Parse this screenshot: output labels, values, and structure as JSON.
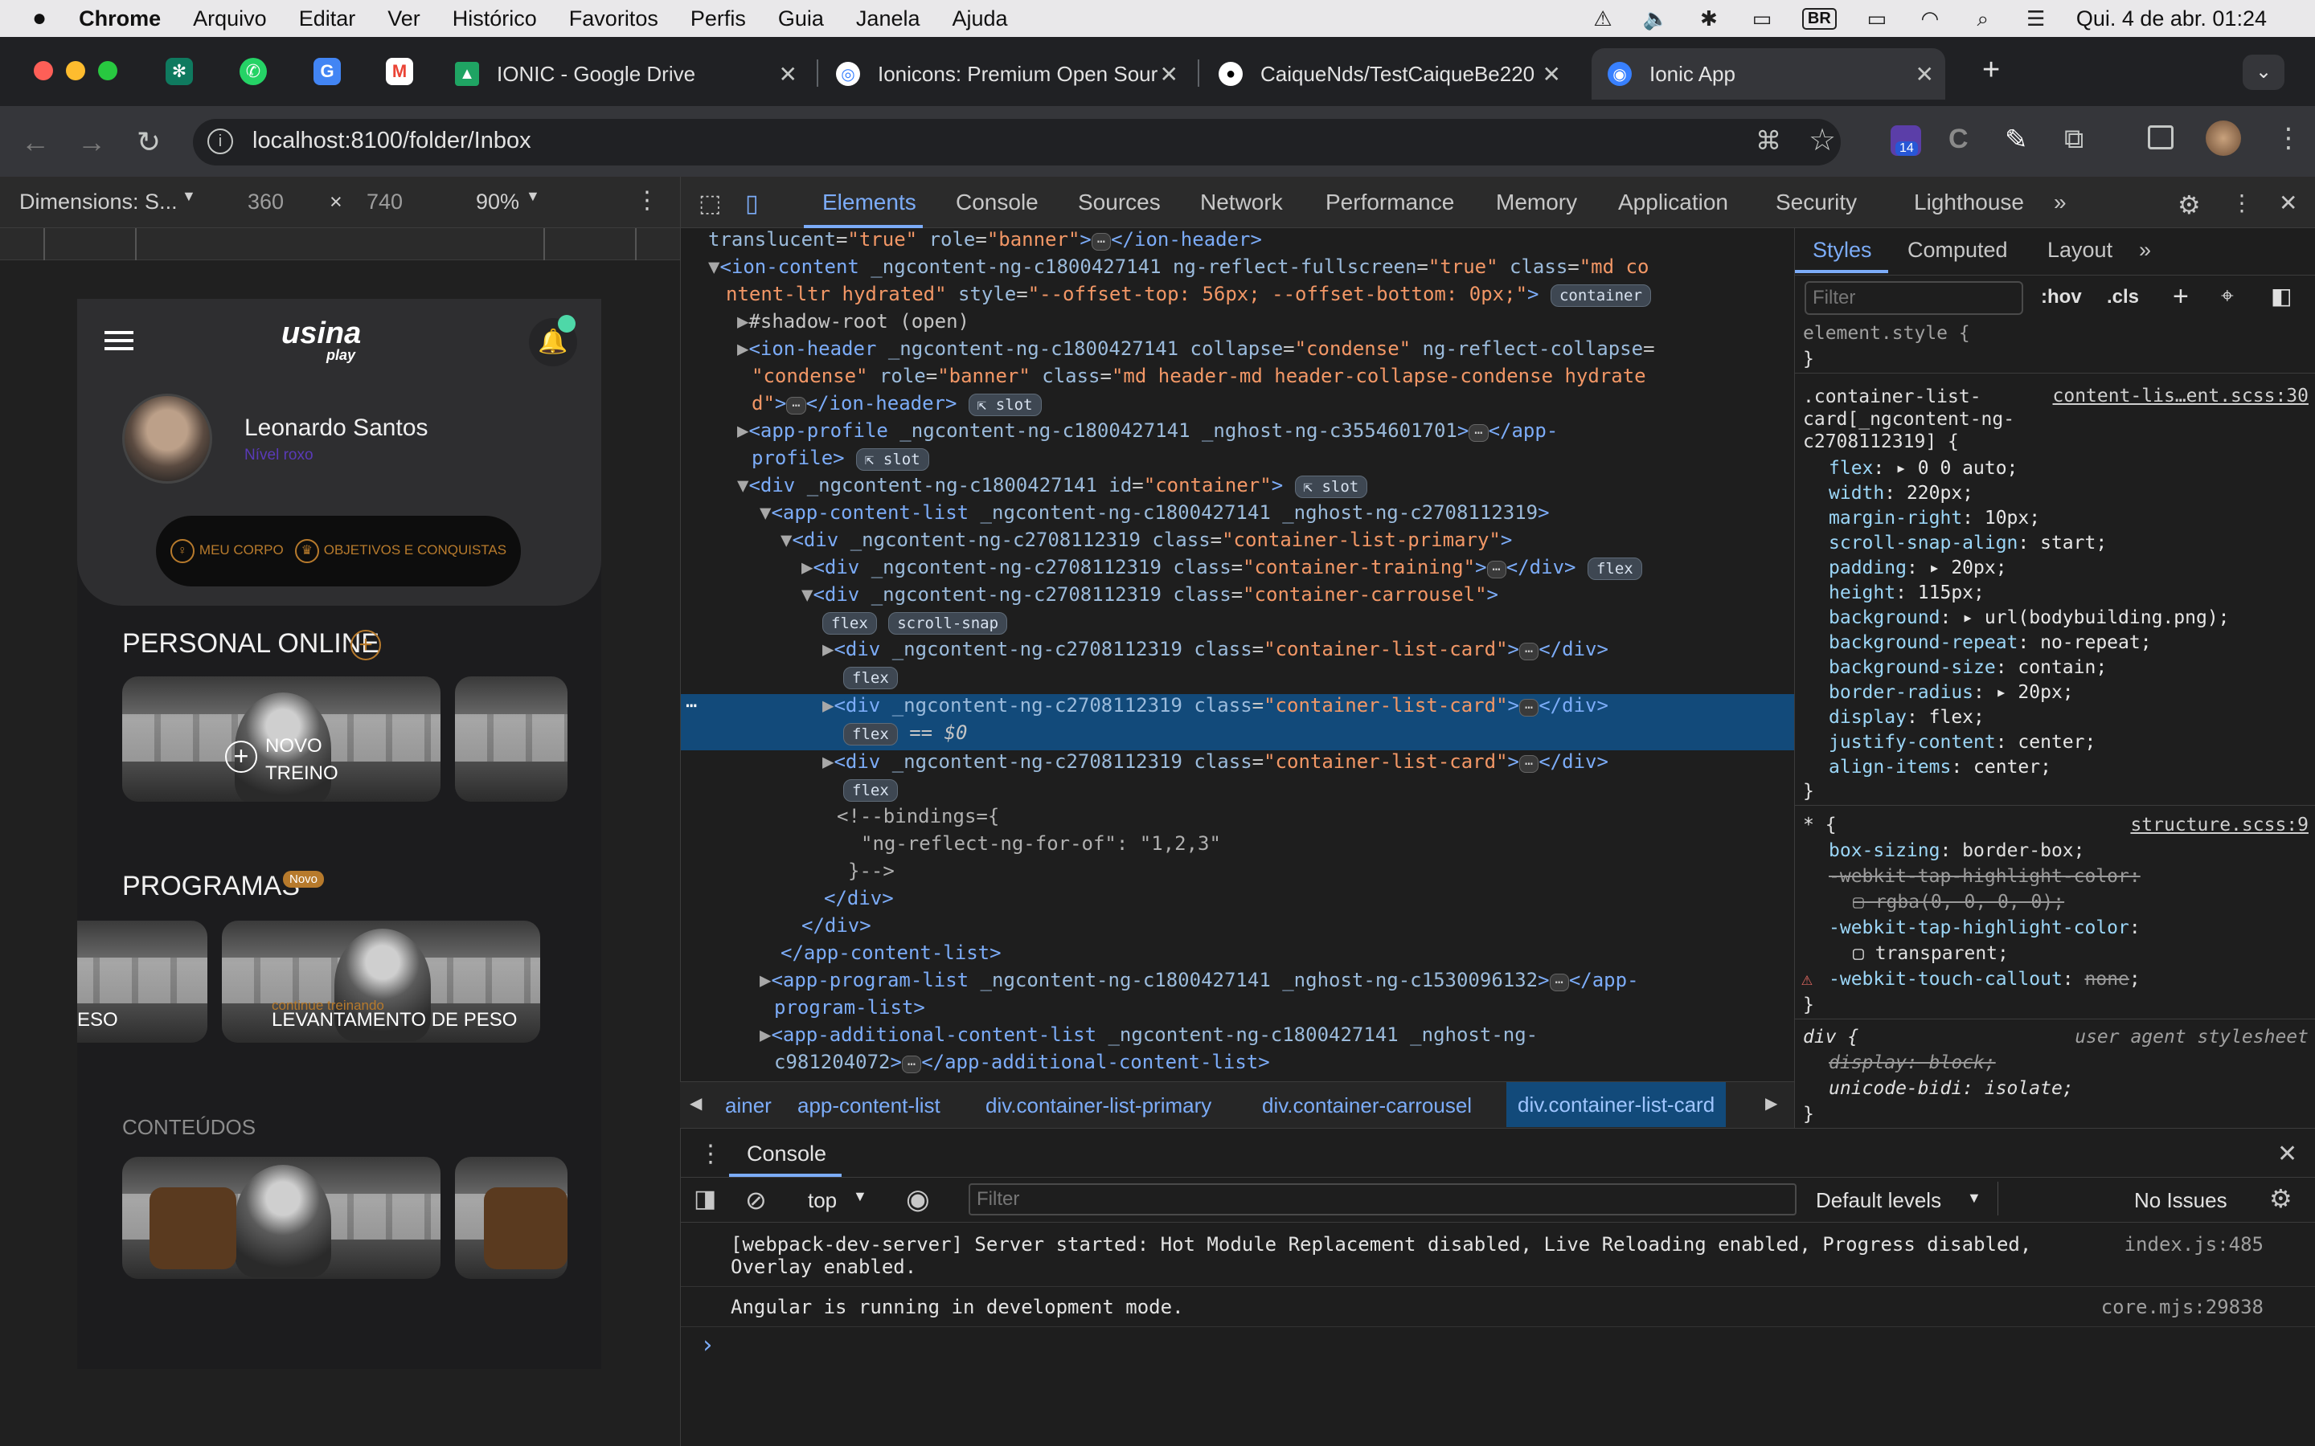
{
  "menubar": {
    "app": "Chrome",
    "items": [
      "Arquivo",
      "Editar",
      "Ver",
      "Histórico",
      "Favoritos",
      "Perfis",
      "Guia",
      "Janela",
      "Ajuda"
    ],
    "input_source": "BR",
    "clock": "Qui. 4 de abr.  01:24"
  },
  "tabs": {
    "items": [
      {
        "title": "IONIC - Google Drive"
      },
      {
        "title": "Ionicons: Premium Open Sour"
      },
      {
        "title": "CaiqueNds/TestCaiqueBe220"
      },
      {
        "title": "Ionic App"
      }
    ],
    "new_tab": "+"
  },
  "toolbar": {
    "url": "localhost:8100/folder/Inbox",
    "extension_badge": "14"
  },
  "device": {
    "dimensions_label": "Dimensions: S...",
    "width": "360",
    "times": "×",
    "height": "740",
    "zoom": "90%"
  },
  "app": {
    "logo_text": "usina",
    "logo_sub": "play",
    "user_name": "Leonardo Santos",
    "user_level": "Nível roxo",
    "pill_items": [
      "MEU CORPO",
      "OBJETIVOS E CONQUISTAS"
    ],
    "personal_title": "PERSONAL ONLINE",
    "novo_treino": "NOVO\nTREINO",
    "programs_title": "PROGRAMAS",
    "programs_badge": "Novo",
    "program_cards": [
      "ESO",
      "LEVANTAMENTO DE PESO"
    ],
    "continue_label": "continue treinando",
    "contents_title": "CONTEÚDOS"
  },
  "devtools": {
    "tabs": [
      "Elements",
      "Console",
      "Sources",
      "Network",
      "Performance",
      "Memory",
      "Application",
      "Security",
      "Lighthouse"
    ],
    "breadcrumbs": [
      "ainer",
      "app-content-list",
      "div.container-list-primary",
      "div.container-carrousel",
      "div.container-list-card"
    ],
    "styles_tabs": [
      "Styles",
      "Computed",
      "Layout"
    ],
    "filter_placeholder": "Filter",
    "hov": ":hov",
    "cls": ".cls"
  },
  "elements_lines": [
    "translucent=\"true\" role=\"banner\">",
    "</ion-header>"
  ],
  "styles": {
    "element_style": "element.style {",
    "rule1_selector": ".container-list-card[_ngcontent-ng-c2708112319] {",
    "rule1_source": "content-lis…ent.scss:30",
    "rule1_props": [
      {
        "p": "flex",
        "v": "▸ 0 0 auto;"
      },
      {
        "p": "width",
        "v": "220px;"
      },
      {
        "p": "margin-right",
        "v": "10px;"
      },
      {
        "p": "scroll-snap-align",
        "v": "start;"
      },
      {
        "p": "padding",
        "v": "▸ 20px;"
      },
      {
        "p": "height",
        "v": "115px;"
      },
      {
        "p": "background",
        "v": "▸ url(bodybuilding.png);"
      },
      {
        "p": "background-repeat",
        "v": "no-repeat;"
      },
      {
        "p": "background-size",
        "v": "contain;"
      },
      {
        "p": "border-radius",
        "v": "▸ 20px;"
      },
      {
        "p": "display",
        "v": "flex;"
      },
      {
        "p": "justify-content",
        "v": "center;"
      },
      {
        "p": "align-items",
        "v": "center;"
      }
    ],
    "rule2_source": "structure.scss:9",
    "rule3_source": "user agent stylesheet"
  },
  "console": {
    "title": "Console",
    "context": "top",
    "filter_placeholder": "Filter",
    "levels": "Default levels",
    "issues": "No Issues",
    "messages": [
      {
        "text": "[webpack-dev-server] Server started: Hot Module Replacement disabled, Live Reloading enabled, Progress disabled,",
        "text2": "Overlay enabled.",
        "src": "index.js:485"
      },
      {
        "text": "Angular is running in development mode.",
        "text2": "",
        "src": "core.mjs:29838"
      }
    ],
    "prompt": "›"
  }
}
